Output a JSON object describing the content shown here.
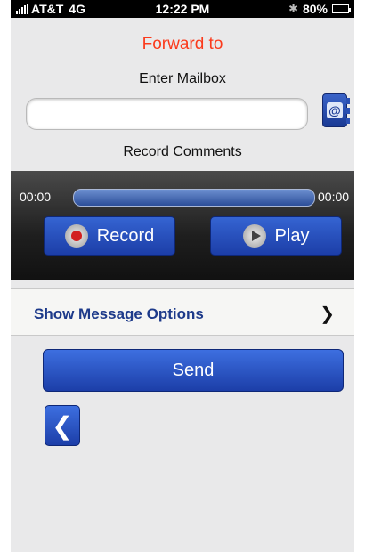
{
  "status_bar": {
    "carrier": "AT&T",
    "network": "4G",
    "time": "12:22 PM",
    "battery": "80%",
    "battery_level": 0.8
  },
  "screen": {
    "title": "Forward to",
    "mailbox_label": "Enter Mailbox",
    "mailbox_value": "",
    "record_label": "Record Comments"
  },
  "recorder": {
    "elapsed": "00:00",
    "duration": "00:00",
    "record_label": "Record",
    "play_label": "Play"
  },
  "options": {
    "label": "Show Message Options"
  },
  "actions": {
    "send_label": "Send"
  },
  "colors": {
    "title": "#fb3a1c",
    "button_blue": "#1c3ea8",
    "options_text": "#1d3a8a"
  },
  "icons": {
    "contacts": "address-book-icon",
    "back": "chevron-left-icon"
  }
}
